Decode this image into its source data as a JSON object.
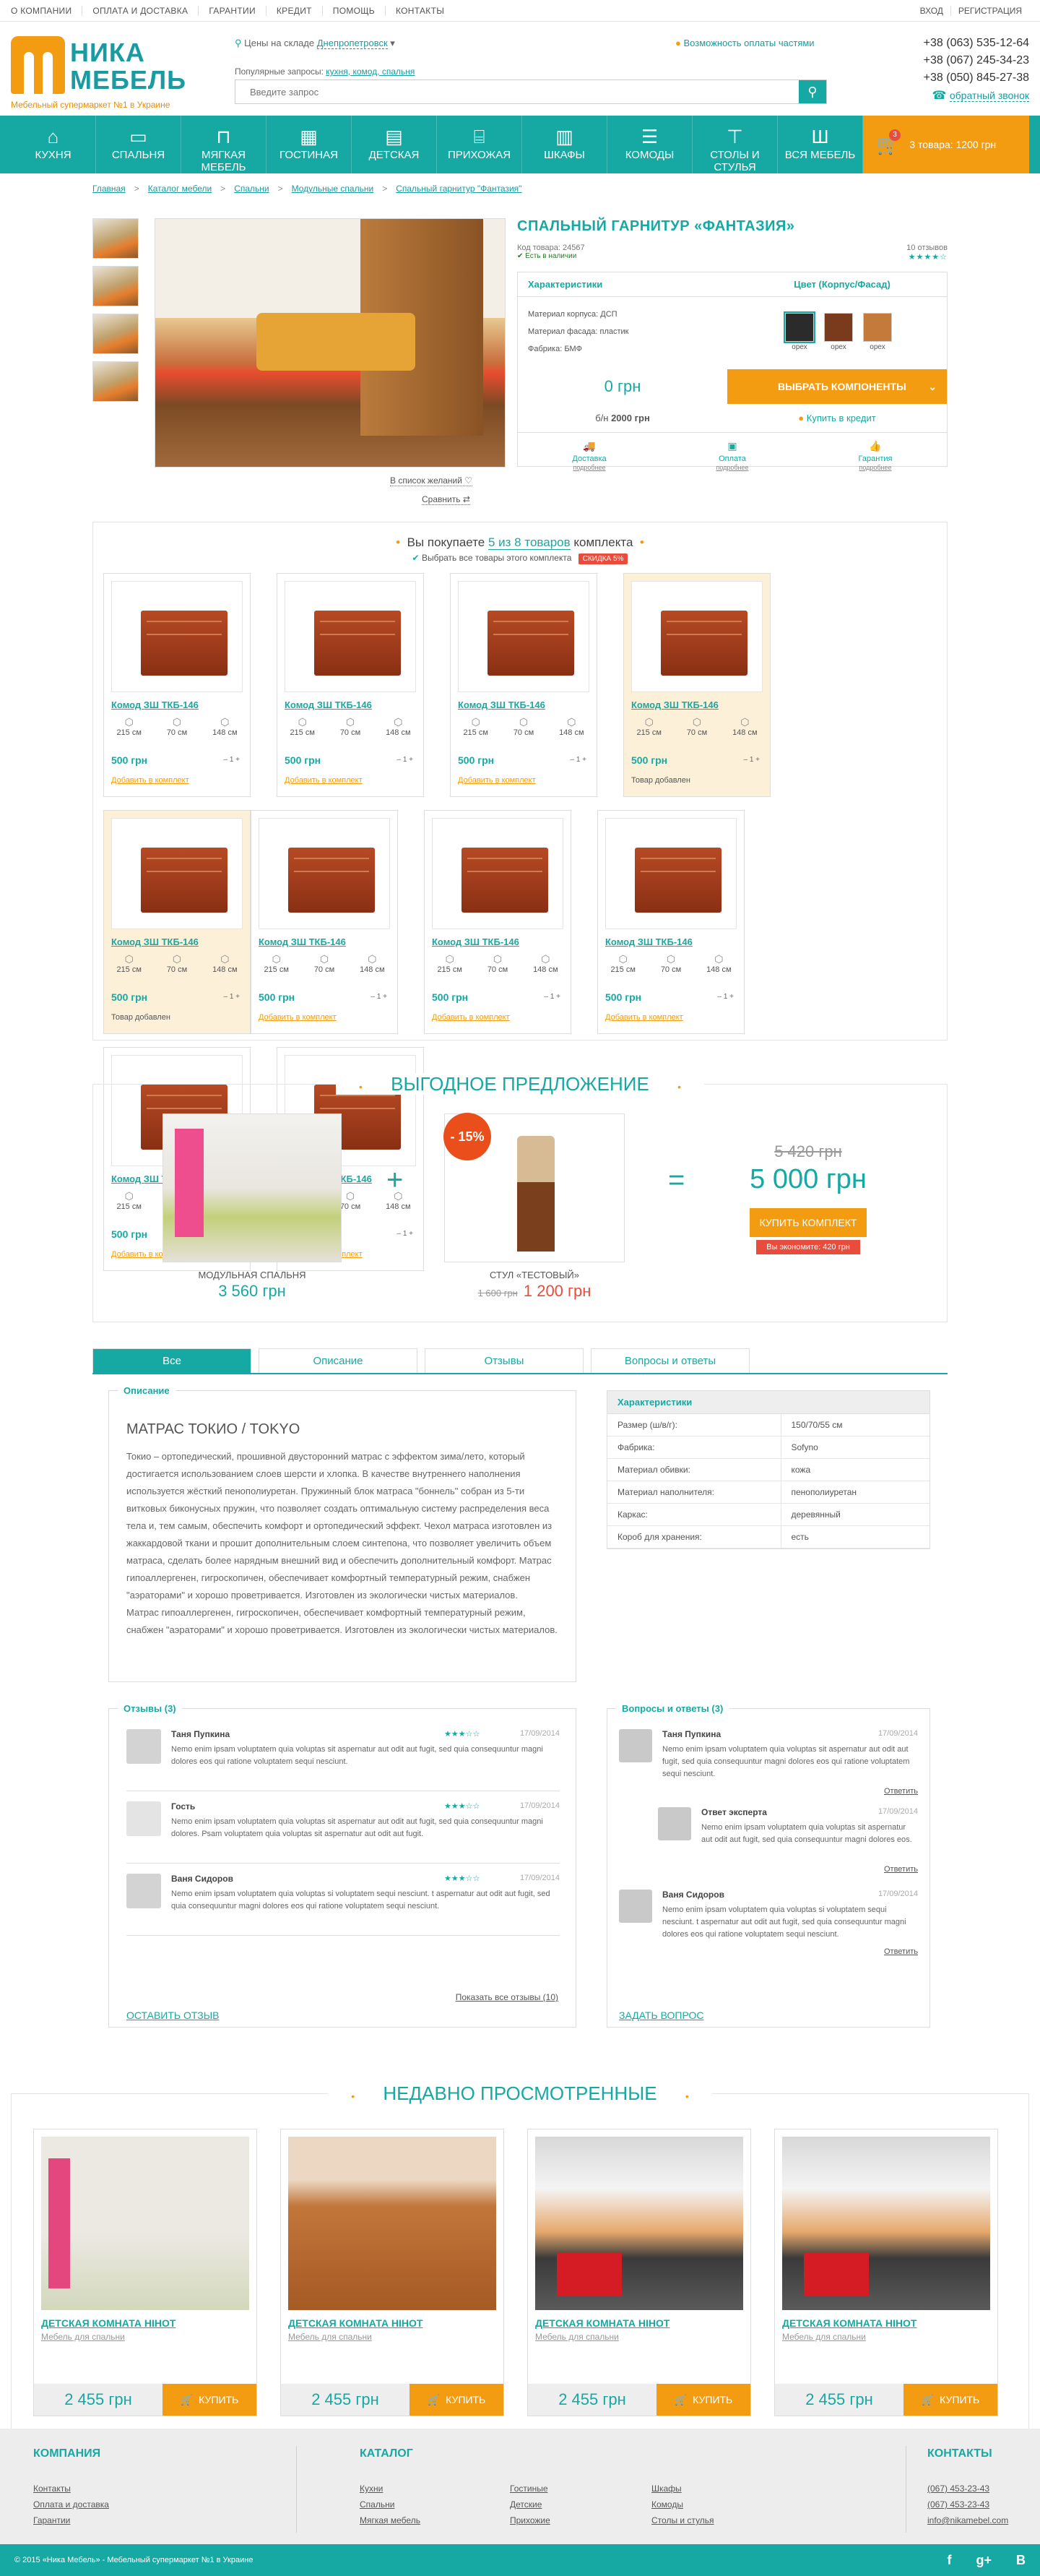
{
  "topbar": {
    "links": [
      "О КОМПАНИИ",
      "ОПЛАТА И ДОСТАВКА",
      "ГАРАНТИИ",
      "КРЕДИТ",
      "ПОМОЩЬ",
      "КОНТАКТЫ"
    ],
    "login": "ВХОД",
    "register": "РЕГИСТРАЦИЯ"
  },
  "header": {
    "logo_line1": "НИКА",
    "logo_line2": "МЕБЕЛЬ",
    "tagline": "Мебельный супермаркет №1 в Украине",
    "city_label": "Цены на складе",
    "city": "Днепропетровск",
    "credit": "Возможность оплаты частями",
    "popular_label": "Популярные запросы:",
    "popular": "кухня, комод, спальня",
    "search_placeholder": "Введите запрос",
    "phones": [
      "+38 (063) 535-12-64",
      "+38 (067) 245-34-23",
      "+38 (050) 845-27-38"
    ],
    "callback": "обратный звонок"
  },
  "nav": {
    "items": [
      "КУХНЯ",
      "СПАЛЬНЯ",
      "МЯГКАЯ МЕБЕЛЬ",
      "ГОСТИНАЯ",
      "ДЕТСКАЯ",
      "ПРИХОЖАЯ",
      "ШКАФЫ",
      "КОМОДЫ",
      "СТОЛЫ И СТУЛЬЯ",
      "ВСЯ МЕБЕЛЬ"
    ],
    "icons": [
      "kitchen-icon",
      "bed-icon",
      "sofa-icon",
      "living-room-icon",
      "kids-room-icon",
      "hallway-icon",
      "wardrobe-icon",
      "dresser-icon",
      "table-chairs-icon",
      "all-furniture-icon"
    ],
    "cart_count": "3",
    "cart_text": "3 товара: 1200 грн"
  },
  "breadcrumb": [
    "Главная",
    "Каталог мебели",
    "Спальни",
    "Модульные спальни",
    "Спальный гарнитур \"Фантазия\""
  ],
  "product": {
    "title": "СПАЛЬНЫЙ ГАРНИТУР «ФАНТАЗИЯ»",
    "code": "Код товара: 24567",
    "stock": "Есть в наличии",
    "reviews": "10 отзывов",
    "stars": "★★★★☆",
    "wishlist": "В список желаний",
    "compare": "Сравнить",
    "chars_title": "Характеристики",
    "color_title": "Цвет (Корпус/Фасад)",
    "chars": [
      "Материал корпуса: ДСП",
      "Материал фасада: пластик",
      "Фабрика: БМФ"
    ],
    "colors": [
      {
        "name": "орех",
        "hex": "#2b2b2b"
      },
      {
        "name": "орех",
        "hex": "#7a3a1c"
      },
      {
        "name": "орех",
        "hex": "#c47a3a"
      }
    ],
    "price": "0 грн",
    "select_btn": "ВЫБРАТЬ КОМПОНЕНТЫ",
    "installment_prefix": "б/н",
    "installment_value": "2000 грн",
    "credit_btn": "Купить в кредит",
    "perks": [
      {
        "title": "Доставка",
        "sub": "подробнее"
      },
      {
        "title": "Оплата",
        "sub": "подробнее"
      },
      {
        "title": "Гарантия",
        "sub": "подробнее"
      }
    ]
  },
  "set": {
    "prefix": "Вы покупаете",
    "count": "5 из 8 товаров",
    "suffix": "комплекта",
    "select_all": "Выбрать все товары этого комплекта",
    "discount": "СКИДКА 5%",
    "items": [
      {
        "name": "Комод ЗШ ТКБ-146",
        "w": "215 см",
        "h": "70 см",
        "d": "148 см",
        "price": "500 грн",
        "qty": "1",
        "action": "Добавить в комплект",
        "added": false
      },
      {
        "name": "Комод ЗШ ТКБ-146",
        "w": "215 см",
        "h": "70 см",
        "d": "148 см",
        "price": "500 грн",
        "qty": "1",
        "action": "Добавить в комплект",
        "added": false
      },
      {
        "name": "Комод ЗШ ТКБ-146",
        "w": "215 см",
        "h": "70 см",
        "d": "148 см",
        "price": "500 грн",
        "qty": "1",
        "action": "Добавить в комплект",
        "added": false
      },
      {
        "name": "Комод ЗШ ТКБ-146",
        "w": "215 см",
        "h": "70 см",
        "d": "148 см",
        "price": "500 грн",
        "qty": "1",
        "action": "Товар добавлен",
        "added": true
      },
      {
        "name": "Комод ЗШ ТКБ-146",
        "w": "215 см",
        "h": "70 см",
        "d": "148 см",
        "price": "500 грн",
        "qty": "1",
        "action": "Товар добавлен",
        "added": true
      },
      {
        "name": "Комод ЗШ ТКБ-146",
        "w": "215 см",
        "h": "70 см",
        "d": "148 см",
        "price": "500 грн",
        "qty": "1",
        "action": "Добавить в комплект",
        "added": false
      },
      {
        "name": "Комод ЗШ ТКБ-146",
        "w": "215 см",
        "h": "70 см",
        "d": "148 см",
        "price": "500 грн",
        "qty": "1",
        "action": "Добавить в комплект",
        "added": false
      },
      {
        "name": "Комод ЗШ ТКБ-146",
        "w": "215 см",
        "h": "70 см",
        "d": "148 см",
        "price": "500 грн",
        "qty": "1",
        "action": "Добавить в комплект",
        "added": false
      },
      {
        "name": "Комод ЗШ ТКБ-146",
        "w": "215 см",
        "h": "70 см",
        "d": "148 см",
        "price": "500 грн",
        "qty": "1",
        "action": "Добавить в комплект",
        "added": false
      },
      {
        "name": "Комод ЗШ ТКБ-146",
        "w": "215 см",
        "h": "70 см",
        "d": "148 см",
        "price": "500 грн",
        "qty": "1",
        "action": "Добавить в комплект",
        "added": false
      }
    ]
  },
  "offer": {
    "title": "ВЫГОДНОЕ ПРЕДЛОЖЕНИЕ",
    "item1_name": "МОДУЛЬНАЯ СПАЛЬНЯ",
    "item1_price": "3 560 грн",
    "item2_badge": "- 15%",
    "item2_name": "СТУЛ «ТЕСТОВЫЙ»",
    "item2_old": "1 600 грн",
    "item2_new": "1 200 грн",
    "total_old": "5 420 грн",
    "total_new": "5 000 грн",
    "buy": "КУПИТЬ КОМПЛЕКТ",
    "save": "Вы экономите: 420 грн"
  },
  "tabs": [
    "Все",
    "Описание",
    "Отзывы",
    "Вопросы и ответы"
  ],
  "description": {
    "label": "Описание",
    "title": "МАТРАС ТОКИО / TOKYO",
    "paragraphs": [
      "Токио – ортопедический, прошивной двусторонний матрас с эффектом зима/лето, который достигается использованием слоев шерсти и хлопка. В качестве внутреннего наполнения используется жёсткий пенополиуретан. Пружинный блок матрасa \"боннель\" собран из 5-ти витковых биконусных пружин, что позволяет создать оптимальную систему распределения веса тела и, тем самым, обеспечить комфорт и ортопедический эффект. Чехол матраса изготовлен из жаккардовой ткани и прошит дополнительным слоем синтепона, что позволяет увеличить объем матраса, сделать более нарядным внешний вид и обеспечить дополнительный комфорт. Матрас гипоаллергенен, гигроскопичен, обеспечивает комфортный температурный режим, снабжен \"аэраторами\" и хорошо проветривается. Изготовлен из экологически чистых материалов.",
      "Матрас гипоаллергенен, гигроскопичен, обеспечивает комфортный температурный режим, снабжен \"аэраторами\" и хорошо проветривается. Изготовлен из экологически чистых материалов."
    ]
  },
  "characteristics": {
    "label": "Характеристики",
    "rows": [
      [
        "Размер (ш/в/г):",
        "150/70/55 см"
      ],
      [
        "Фабрика:",
        "Sofyno"
      ],
      [
        "Материал обивки:",
        "кожа"
      ],
      [
        "Материал наполнителя:",
        "пенополиуретан"
      ],
      [
        "Каркас:",
        "деревянный"
      ],
      [
        "Короб для хранения:",
        "есть"
      ]
    ]
  },
  "reviews": {
    "label": "Отзывы (3)",
    "items": [
      {
        "name": "Таня Пупкина",
        "date": "17/09/2014",
        "stars": "★★★☆☆",
        "text": "Nemo enim ipsam voluptatem quia voluptas sit aspernatur aut odit aut fugit, sed quia consequuntur magni dolores eos qui ratione voluptatem sequi nesciunt."
      },
      {
        "name": "Гость",
        "date": "17/09/2014",
        "stars": "★★★☆☆",
        "text": "Nemo enim ipsam voluptatem quia voluptas sit aspernatur aut odit aut fugit, sed quia consequuntur magni dolores. Psam voluptatem quia voluptas sit aspernatur aut odit aut fugit."
      },
      {
        "name": "Ваня Сидоров",
        "date": "17/09/2014",
        "stars": "★★★☆☆",
        "text": "Nemo enim ipsam voluptatem quia voluptas si voluptatem sequi nesciunt. t aspernatur aut odit aut fugit, sed quia consequuntur magni dolores eos qui ratione voluptatem sequi nesciunt."
      }
    ],
    "more": "Показать все отзывы (10)",
    "leave": "ОСТАВИТЬ ОТЗЫВ"
  },
  "qa": {
    "label": "Вопросы и ответы (3)",
    "items": [
      {
        "name": "Таня Пупкина",
        "date": "17/09/2014",
        "text": "Nemo enim ipsam voluptatem quia voluptas sit aspernatur aut odit aut fugit, sed quia consequuntur magni dolores eos qui ratione voluptatem sequi nesciunt.",
        "answer": "Ответить"
      },
      {
        "name": "Ответ эксперта",
        "date": "17/09/2014",
        "text": "Nemo enim ipsam voluptatem quia voluptas sit aspernatur aut odit aut fugit, sed quia consequuntur magni dolores eos.",
        "answer": "Ответить"
      },
      {
        "name": "Ваня Сидоров",
        "date": "17/09/2014",
        "text": "Nemo enim ipsam voluptatem quia voluptas si voluptatem sequi nesciunt. t aspernatur aut odit aut fugit, sed quia consequuntur magni dolores eos qui ratione voluptatem sequi nesciunt.",
        "answer": "Ответить"
      }
    ],
    "ask": "ЗАДАТЬ ВОПРОС"
  },
  "recent": {
    "title": "НЕДАВНО ПРОСМОТРЕННЫЕ",
    "items": [
      {
        "name": "ДЕТСКАЯ КОМНАТА HIHOT",
        "sub": "Мебель для спальни",
        "price": "2 455 грн",
        "buy": "КУПИТЬ",
        "style": "kids"
      },
      {
        "name": "ДЕТСКАЯ КОМНАТА HIHOT",
        "sub": "Мебель для спальни",
        "price": "2 455 грн",
        "buy": "КУПИТЬ",
        "style": "wood"
      },
      {
        "name": "ДЕТСКАЯ КОМНАТА HIHOT",
        "sub": "Мебель для спальни",
        "price": "2 455 грн",
        "buy": "КУПИТЬ",
        "style": "kitchen"
      },
      {
        "name": "ДЕТСКАЯ КОМНАТА HIHOT",
        "sub": "Мебель для спальни",
        "price": "2 455 грн",
        "buy": "КУПИТЬ",
        "style": "kitchen"
      }
    ]
  },
  "footer": {
    "company_title": "КОМПАНИЯ",
    "company_links": [
      "Контакты",
      "Оплата и доставка",
      "Гарантии"
    ],
    "catalog_title": "КАТАЛОГ",
    "catalog_col1": [
      "Кухни",
      "Спальни",
      "Мягкая мебель"
    ],
    "catalog_col2": [
      "Гостиные",
      "Детские",
      "Прихожие"
    ],
    "catalog_col3": [
      "Шкафы",
      "Комоды",
      "Столы и стулья"
    ],
    "contacts_title": "КОНТАКТЫ",
    "contacts": [
      "(067) 453-23-43",
      "(067) 453-23-43",
      "info@nikamebel.com"
    ],
    "copyright": "© 2015 «Ника Мебель» - Мебельный супермаркет №1 в Украине",
    "social": [
      "f",
      "g+",
      "B"
    ]
  },
  "colors": {
    "accent": "#16a9a4",
    "orange": "#f39c12",
    "red": "#e74c3c"
  }
}
